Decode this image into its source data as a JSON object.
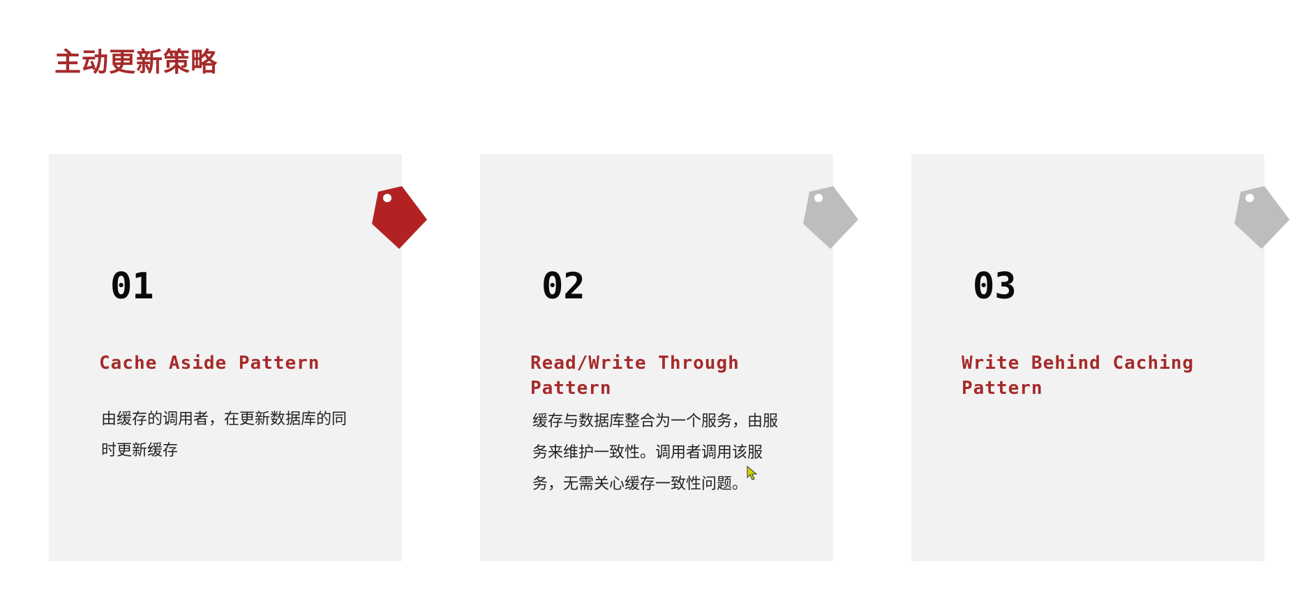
{
  "page": {
    "title": "主动更新策略"
  },
  "colors": {
    "accent": "#a52a2a",
    "card_bg": "#f2f2f2",
    "tag_active": "#b22222",
    "tag_inactive": "#bdbdbd"
  },
  "cards": [
    {
      "number": "01",
      "title": "Cache Aside Pattern",
      "description": "由缓存的调用者，在更新数据库的同时更新缓存",
      "tag_icon": "price-tag-icon",
      "tag_state": "active"
    },
    {
      "number": "02",
      "title": "Read/Write Through Pattern",
      "description": "缓存与数据库整合为一个服务，由服务来维护一致性。调用者调用该服务，无需关心缓存一致性问题。",
      "tag_icon": "price-tag-icon",
      "tag_state": "inactive"
    },
    {
      "number": "03",
      "title": "Write Behind Caching Pattern",
      "description": "",
      "tag_icon": "price-tag-icon",
      "tag_state": "inactive"
    }
  ]
}
